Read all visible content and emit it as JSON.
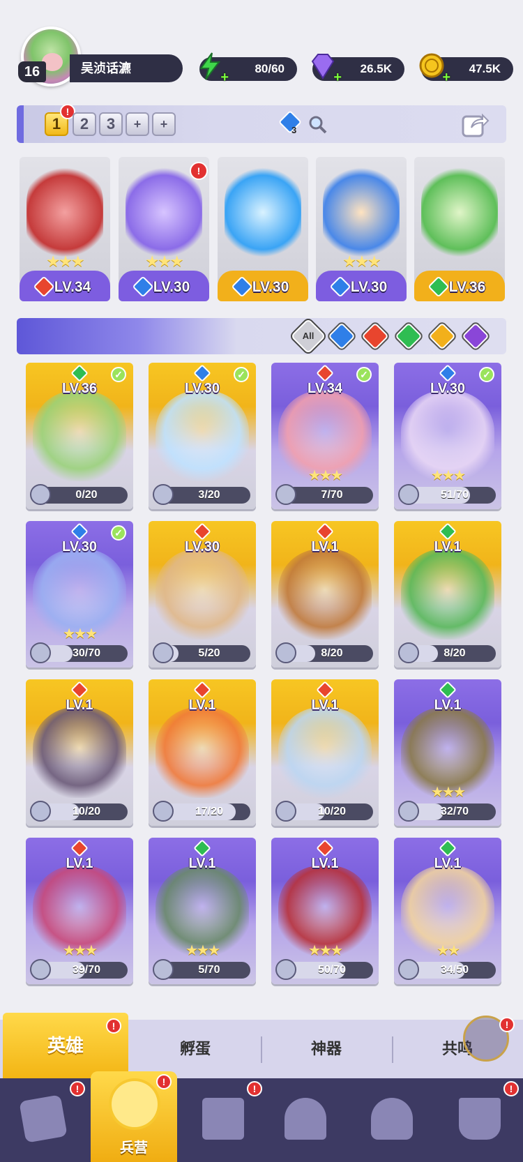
{
  "player": {
    "level": "16",
    "name": "吴浈话瀌"
  },
  "resources": {
    "energy": "80/60",
    "gems": "26.5K",
    "coins": "47.5K"
  },
  "teams": [
    "1",
    "2",
    "3",
    "+",
    "+"
  ],
  "team_search": {
    "badge": "3"
  },
  "lineup": [
    {
      "level": "LV.34",
      "element": "fire",
      "stars": "★★★",
      "base": "purple"
    },
    {
      "level": "LV.30",
      "element": "water",
      "stars": "★★★",
      "base": "purple"
    },
    {
      "level": "LV.30",
      "element": "water",
      "stars": "",
      "base": "gold"
    },
    {
      "level": "LV.30",
      "element": "water",
      "stars": "★★★",
      "base": "purple"
    },
    {
      "level": "LV.36",
      "element": "nature",
      "stars": "",
      "base": "gold"
    }
  ],
  "filters": {
    "all_label": "All"
  },
  "colors": {
    "fire": "#e8452e",
    "water": "#2f7fe8",
    "nature": "#2fbd52",
    "light": "#f2b01b",
    "dark": "#8a46d8",
    "gold_card": "#f2b91b",
    "purple_card": "#7d5fdc"
  },
  "heroes": [
    {
      "level": "LV.36",
      "element": "nature",
      "shards": "0/20",
      "progress": 0.0,
      "stars": "",
      "check": true,
      "rarity": "gold"
    },
    {
      "level": "LV.30",
      "element": "water",
      "shards": "3/20",
      "progress": 0.15,
      "stars": "",
      "check": true,
      "rarity": "gold"
    },
    {
      "level": "LV.34",
      "element": "fire",
      "shards": "7/70",
      "progress": 0.1,
      "stars": "★★★",
      "check": true,
      "rarity": "purple"
    },
    {
      "level": "LV.30",
      "element": "water",
      "shards": "51/70",
      "progress": 0.73,
      "stars": "★★★",
      "check": true,
      "rarity": "purple"
    },
    {
      "level": "LV.30",
      "element": "water",
      "shards": "30/70",
      "progress": 0.43,
      "stars": "★★★",
      "check": true,
      "rarity": "purple"
    },
    {
      "level": "LV.30",
      "element": "fire",
      "shards": "5/20",
      "progress": 0.25,
      "stars": "",
      "check": false,
      "rarity": "gold"
    },
    {
      "level": "LV.1",
      "element": "fire",
      "shards": "8/20",
      "progress": 0.4,
      "stars": "",
      "check": false,
      "rarity": "gold"
    },
    {
      "level": "LV.1",
      "element": "nature",
      "shards": "8/20",
      "progress": 0.4,
      "stars": "",
      "check": false,
      "rarity": "gold"
    },
    {
      "level": "LV.1",
      "element": "fire",
      "shards": "10/20",
      "progress": 0.5,
      "stars": "",
      "check": false,
      "rarity": "gold"
    },
    {
      "level": "LV.1",
      "element": "fire",
      "shards": "17/20",
      "progress": 0.85,
      "stars": "",
      "check": false,
      "rarity": "gold"
    },
    {
      "level": "LV.1",
      "element": "fire",
      "shards": "10/20",
      "progress": 0.5,
      "stars": "",
      "check": false,
      "rarity": "gold"
    },
    {
      "level": "LV.1",
      "element": "nature",
      "shards": "32/70",
      "progress": 0.46,
      "stars": "★★★",
      "check": false,
      "rarity": "purple"
    },
    {
      "level": "LV.1",
      "element": "fire",
      "shards": "39/70",
      "progress": 0.56,
      "stars": "★★★",
      "check": false,
      "rarity": "purple"
    },
    {
      "level": "LV.1",
      "element": "nature",
      "shards": "5/70",
      "progress": 0.07,
      "stars": "★★★",
      "check": false,
      "rarity": "purple"
    },
    {
      "level": "LV.1",
      "element": "fire",
      "shards": "50/70",
      "progress": 0.71,
      "stars": "★★★",
      "check": false,
      "rarity": "purple"
    },
    {
      "level": "LV.1",
      "element": "nature",
      "shards": "34/50",
      "progress": 0.68,
      "stars": "★★",
      "check": false,
      "rarity": "purple"
    }
  ],
  "subtabs": [
    "英雄",
    "孵蛋",
    "神器",
    "共鸣"
  ],
  "nav": {
    "active_label": "兵营"
  },
  "alert_mark": "!"
}
